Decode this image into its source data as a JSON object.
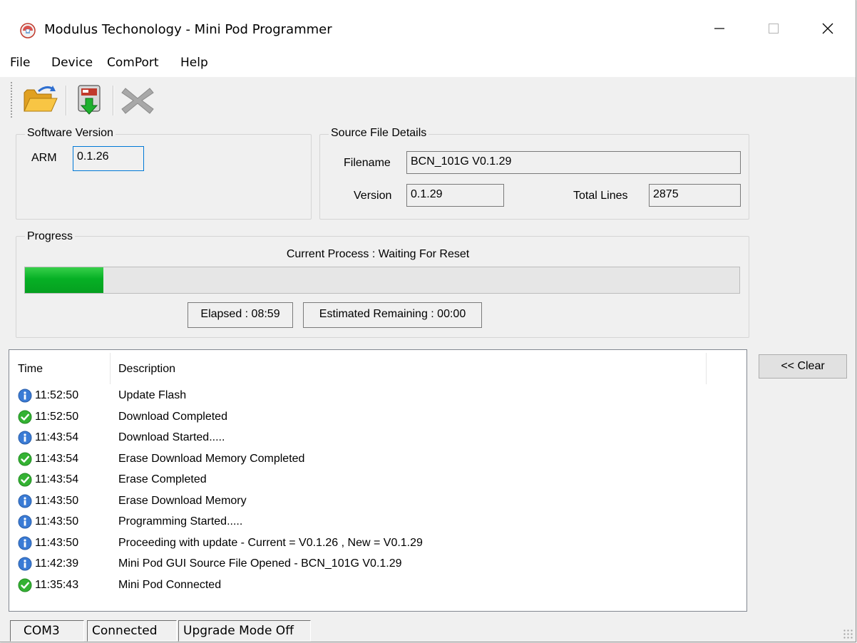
{
  "window": {
    "title": "Modulus Techonology - Mini Pod Programmer",
    "icon": "app-logo-icon",
    "controls": [
      "minimize-icon",
      "maximize-icon",
      "close-icon"
    ]
  },
  "menu": {
    "file": "File",
    "device": "Device",
    "comport": "ComPort",
    "help": "Help"
  },
  "toolbar": {
    "icons": [
      "open-folder-icon",
      "download-to-device-icon",
      "cancel-x-icon"
    ]
  },
  "software_version": {
    "legend": "Software Version",
    "arm_label": "ARM",
    "arm_value": "0.1.26"
  },
  "source_file": {
    "legend": "Source File Details",
    "filename_label": "Filename",
    "filename_value": "BCN_101G V0.1.29",
    "version_label": "Version",
    "version_value": "0.1.29",
    "total_lines_label": "Total Lines",
    "total_lines_value": "2875"
  },
  "progress": {
    "legend": "Progress",
    "current_process": "Current Process :  Waiting For Reset",
    "fraction": 0.11,
    "elapsed": "Elapsed : 08:59",
    "remaining": "Estimated Remaining : 00:00",
    "bar_color": "#06b025"
  },
  "log": {
    "columns": {
      "time": "Time",
      "description": "Description"
    },
    "rows": [
      {
        "icon": "info-icon",
        "time": "11:52:50",
        "desc": "Update Flash"
      },
      {
        "icon": "check-icon",
        "time": "11:52:50",
        "desc": "Download Completed"
      },
      {
        "icon": "info-icon",
        "time": "11:43:54",
        "desc": "Download Started....."
      },
      {
        "icon": "check-icon",
        "time": "11:43:54",
        "desc": "Erase Download Memory Completed"
      },
      {
        "icon": "check-icon",
        "time": "11:43:54",
        "desc": "Erase Completed"
      },
      {
        "icon": "info-icon",
        "time": "11:43:50",
        "desc": "Erase Download Memory"
      },
      {
        "icon": "info-icon",
        "time": "11:43:50",
        "desc": "Programming Started....."
      },
      {
        "icon": "info-icon",
        "time": "11:43:50",
        "desc": "Proceeding with update - Current = V0.1.26  , New = V0.1.29"
      },
      {
        "icon": "info-icon",
        "time": "11:42:39",
        "desc": "Mini Pod GUI Source File Opened - BCN_101G V0.1.29"
      },
      {
        "icon": "check-icon",
        "time": "11:35:43",
        "desc": "Mini Pod Connected"
      }
    ]
  },
  "clear_button": "<< Clear",
  "status": {
    "port": "COM3",
    "connection": "Connected",
    "mode": "Upgrade Mode Off"
  },
  "colors": {
    "info": "#3a7bd5",
    "success": "#34b233",
    "accent": "#0078d7"
  }
}
